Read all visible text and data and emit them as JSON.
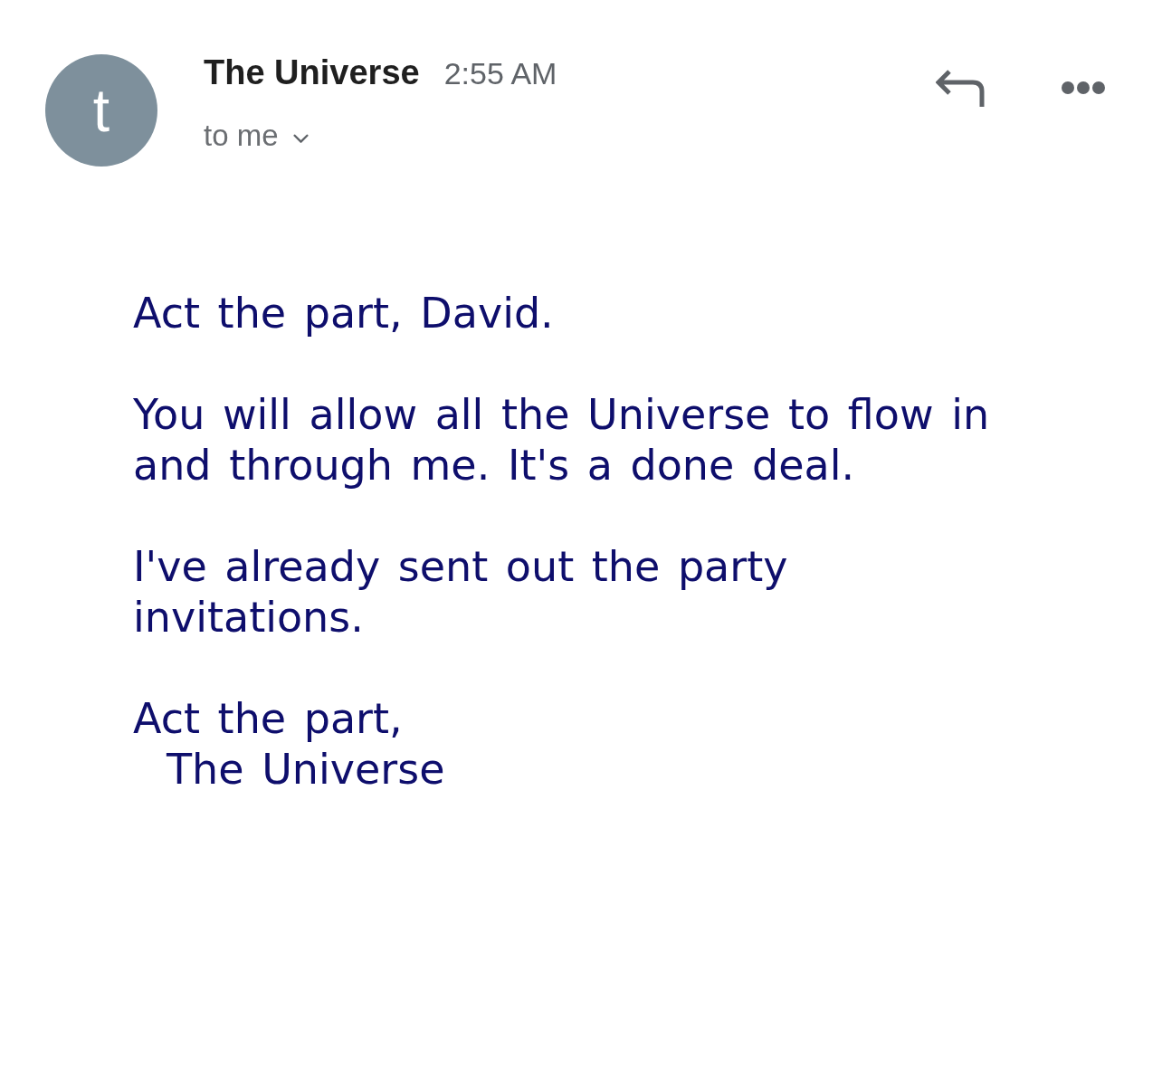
{
  "message": {
    "avatar": {
      "letter": "t"
    },
    "sender": "The Universe",
    "time": "2:55 AM",
    "recipients": "to me",
    "details_expanded": false,
    "body": {
      "paragraphs": [
        "Act the part, David.",
        "You will allow all the Universe to flow in and through me. It's a done deal.",
        "I've already sent out the party invitations."
      ],
      "closing": "Act the part,",
      "signature": "The Universe"
    }
  }
}
